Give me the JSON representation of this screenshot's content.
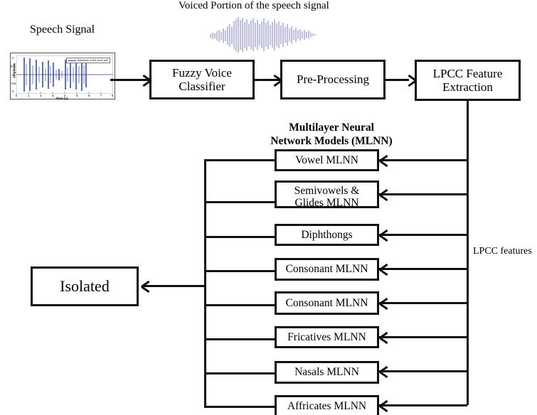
{
  "diagram": {
    "title_top_left": "Speech Signal",
    "title_top_center": "Voiced Portion of the speech signal",
    "mlnn_heading_line1": "Multilayer Neural",
    "mlnn_heading_line2": "Network Models (MLNN)",
    "lpcc_features_label": "LPCC features"
  },
  "pipeline": [
    {
      "id": "fuzzy-voice-classifier",
      "label": "Fuzzy Voice\nClassifier"
    },
    {
      "id": "pre-processing",
      "label": "Pre-Processing"
    },
    {
      "id": "lpcc-feature-extraction",
      "label": "LPCC Feature\nExtraction"
    }
  ],
  "mlnn_boxes": [
    {
      "id": "vowel-mlnn",
      "label": "Vowel MLNN"
    },
    {
      "id": "semivowels-glides-mlnn",
      "label": "Semivowels &\nGlides MLNN"
    },
    {
      "id": "diphthongs",
      "label": "Diphthongs"
    },
    {
      "id": "consonant-mlnn-1",
      "label": "Consonant MLNN"
    },
    {
      "id": "consonant-mlnn-2",
      "label": "Consonant MLNN"
    },
    {
      "id": "fricatives-mlnn",
      "label": "Fricatives MLNN"
    },
    {
      "id": "nasals-mlnn",
      "label": "Nasals MLNN"
    },
    {
      "id": "affricates-mlnn",
      "label": "Affricates MLNN"
    }
  ],
  "output": {
    "id": "isolated",
    "label": "Isolated"
  },
  "waveform_plot": {
    "legend_text": "Waveform of the word \"pat\"",
    "xlabel": "Time (s)",
    "ylabel": "Amplitude",
    "xticks": [
      "0",
      "1",
      "2",
      "3",
      "4",
      "5",
      "6",
      "7",
      "8"
    ],
    "yticks": [
      "1",
      "0.5",
      "0",
      "-0.5",
      "-1"
    ],
    "xlim": [
      0,
      8
    ],
    "ylim": [
      -1,
      1
    ],
    "trace_color": "#2f3fa0"
  },
  "voiced_waveform": {
    "trace_color": "#6a6ec0"
  },
  "chart_data": {
    "type": "line",
    "title": "Waveform of the word \"pat\"",
    "xlabel": "Time (s)",
    "ylabel": "Amplitude",
    "xlim": [
      0,
      8
    ],
    "ylim": [
      -1,
      1
    ],
    "xticks": [
      0,
      1,
      2,
      3,
      4,
      5,
      6,
      7,
      8
    ],
    "yticks": [
      -1,
      -0.5,
      0,
      0.5,
      1
    ],
    "grid": false,
    "legend_position": "top-right",
    "series": [
      {
        "name": "Waveform of the word \"pat\"",
        "color": "#2f3fa0",
        "description": "Isolated-word speech waveform: 11 voiced bursts between t=0.6s and t=5.8s, silence elsewhere",
        "burst_times": [
          0.62,
          1.12,
          1.62,
          2.15,
          2.62,
          3.05,
          3.52,
          4.05,
          4.45,
          4.92,
          5.38,
          5.72
        ],
        "burst_peak_amplitudes": [
          0.95,
          0.92,
          0.88,
          0.72,
          0.8,
          0.7,
          0.35,
          0.82,
          0.78,
          0.85,
          0.9,
          0.74
        ]
      }
    ]
  }
}
